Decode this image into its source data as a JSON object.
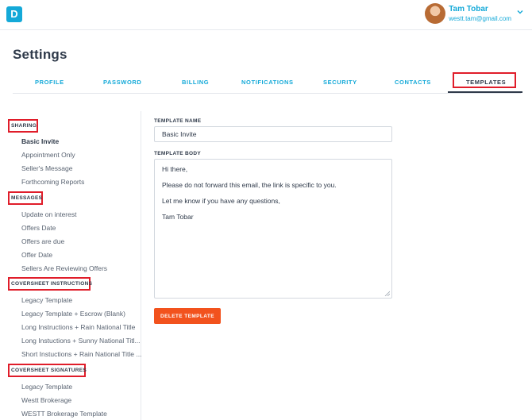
{
  "app": {
    "logo_letter": "D"
  },
  "user": {
    "name": "Tam Tobar",
    "email": "westt.tam@gmail.com"
  },
  "page": {
    "title": "Settings"
  },
  "tabs": [
    {
      "label": "PROFILE"
    },
    {
      "label": "PASSWORD"
    },
    {
      "label": "BILLING"
    },
    {
      "label": "NOTIFICATIONS"
    },
    {
      "label": "SECURITY"
    },
    {
      "label": "CONTACTS"
    },
    {
      "label": "TEMPLATES",
      "active": true
    }
  ],
  "sidebar": {
    "groups": [
      {
        "title": "SHARING",
        "items": [
          "Basic Invite",
          "Appointment Only",
          "Seller's Message",
          "Forthcoming Reports"
        ]
      },
      {
        "title": "MESSAGES",
        "items": [
          "Update on interest",
          "Offers Date",
          "Offers are due",
          "Offer Date",
          "Sellers Are Reviewing Offers"
        ]
      },
      {
        "title": "COVERSHEET INSTRUCTIONS",
        "items": [
          "Legacy Template",
          "Legacy Template + Escrow (Blank)",
          "Long Instructions + Rain National Title",
          "Long Instuctions + Sunny National Titl...",
          "Short Instuctions + Rain National Title ..."
        ]
      },
      {
        "title": "COVERSHEET SIGNATURES",
        "items": [
          "Legacy Template",
          "Westt Brokerage",
          "WESTT Brokerage Template"
        ]
      }
    ],
    "active_item": "Basic Invite"
  },
  "form": {
    "name_label": "TEMPLATE NAME",
    "name_value": "Basic Invite",
    "body_label": "TEMPLATE BODY",
    "body_lines": [
      "Hi there,",
      "Please do not forward this email, the link is specific to you.",
      "Let me know if you have any questions,",
      "Tam Tobar"
    ],
    "delete_label": "DELETE TEMPLATE"
  },
  "colors": {
    "accent": "#14a9d8",
    "danger": "#f2521d",
    "highlight": "#e01d2a",
    "text": "#2f3a4a"
  }
}
